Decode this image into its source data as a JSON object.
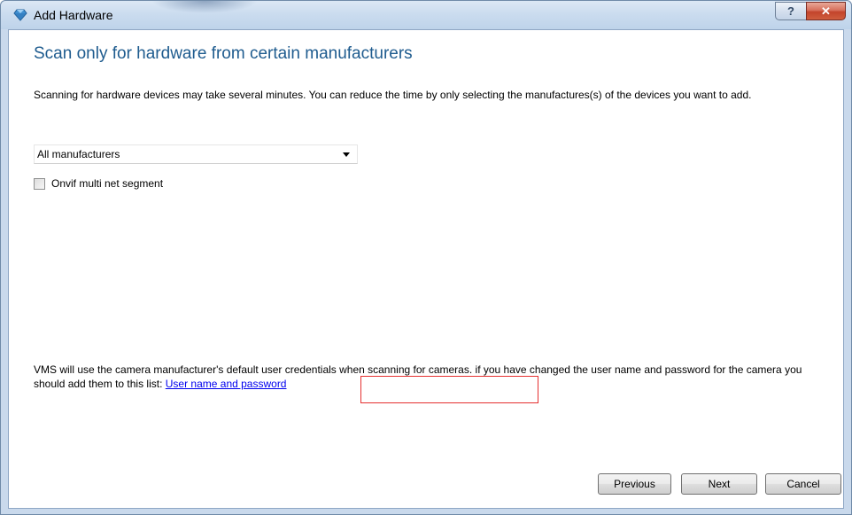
{
  "window": {
    "title": "Add Hardware",
    "help_label": "?",
    "close_label": "✕"
  },
  "page": {
    "heading": "Scan only for hardware from certain manufacturers",
    "description": "Scanning for hardware devices may take several minutes. You can reduce the time by only selecting the manufactures(s) of the devices you want to add."
  },
  "manufacturer_select": {
    "selected": "All manufacturers"
  },
  "onvif_checkbox": {
    "label": "Onvif multi net segment",
    "checked": false
  },
  "credentials_info": {
    "text": "VMS will use the camera manufacturer's default user credentials when scanning for cameras. if you have changed the user name and password for the camera you should add them to this list: ",
    "link_label": "User name and password"
  },
  "buttons": {
    "previous": "Previous",
    "next": "Next",
    "cancel": "Cancel"
  },
  "colors": {
    "heading": "#1f5c8f",
    "link": "#0000ee",
    "highlight": "#e53030",
    "window_frame": "#c9d9ec"
  }
}
